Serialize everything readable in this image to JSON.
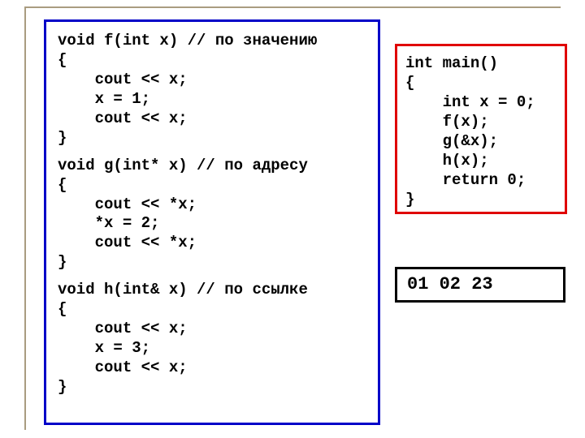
{
  "left_code": {
    "f1": "void f(int x) // по значению",
    "f2": "{",
    "f3": "    cout << x;",
    "f4": "    x = 1;",
    "f5": "    cout << x;",
    "f6": "}",
    "g1": "void g(int* x) // по адресу",
    "g2": "{",
    "g3": "    cout << *x;",
    "g4": "    *x = 2;",
    "g5": "    cout << *x;",
    "g6": "}",
    "h1": "void h(int& x) // по ссылке",
    "h2": "{",
    "h3": "    cout << x;",
    "h4": "    x = 3;",
    "h5": "    cout << x;",
    "h6": "}"
  },
  "right_code": {
    "m1": "int main()",
    "m2": "{",
    "m3": "    int x = 0;",
    "m4": "    f(x);",
    "m5": "    g(&x);",
    "m6": "    h(x);",
    "m7": "    return 0;",
    "m8": "}"
  },
  "output": "01 02 23"
}
